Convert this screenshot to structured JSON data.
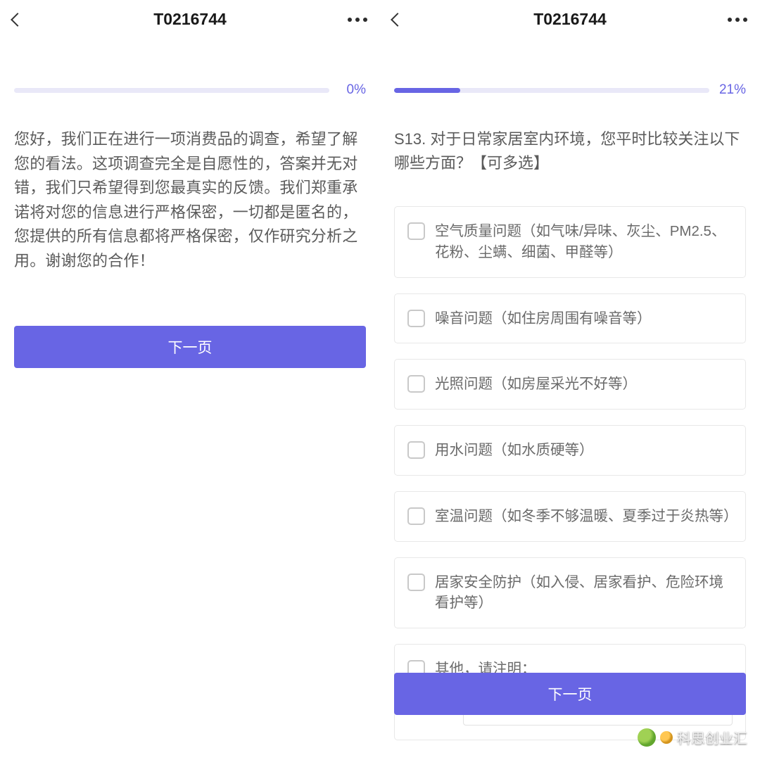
{
  "left": {
    "title": "T0216744",
    "progress_pct": 0,
    "progress_label": "0%",
    "intro": "您好，我们正在进行一项消费品的调查，希望了解您的看法。这项调查完全是自愿性的，答案并无对错，我们只希望得到您最真实的反馈。我们郑重承诺将对您的信息进行严格保密，一切都是匿名的，您提供的所有信息都将严格保密，仅作研究分析之用。谢谢您的合作！",
    "next_label": "下一页"
  },
  "right": {
    "title": "T0216744",
    "progress_pct": 21,
    "progress_label": "21%",
    "question": "S13. 对于日常家居室内环境，您平时比较关注以下哪些方面？【可多选】",
    "options": [
      "空气质量问题（如气味/异味、灰尘、PM2.5、花粉、尘螨、细菌、甲醛等）",
      "噪音问题（如住房周围有噪音等）",
      "光照问题（如房屋采光不好等）",
      "用水问题（如水质硬等）",
      "室温问题（如冬季不够温暖、夏季过于炎热等）",
      "居家安全防护（如入侵、居家看护、危险环境看护等）",
      "其他，请注明："
    ],
    "next_label": "下一页"
  },
  "watermark_text": "科思创业汇"
}
